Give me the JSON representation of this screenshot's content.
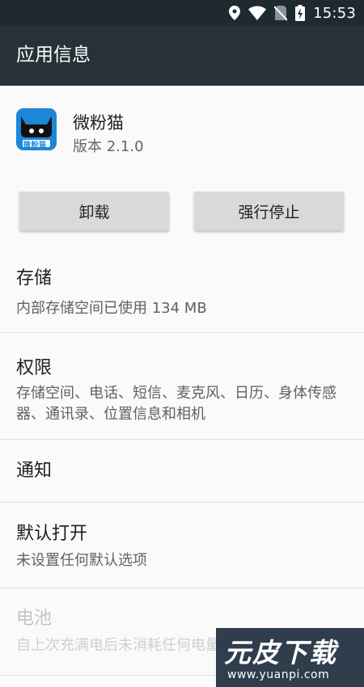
{
  "status_bar": {
    "time": "15:53",
    "icons": [
      "location-icon",
      "wifi-icon",
      "no-sim-icon",
      "battery-charging-icon"
    ]
  },
  "app_bar": {
    "title": "应用信息"
  },
  "app": {
    "name": "微粉猫",
    "version": "版本 2.1.0",
    "icon_label": "微粉猫",
    "icon_color": "#1c86d8"
  },
  "buttons": {
    "uninstall": "卸载",
    "force_stop": "强行停止"
  },
  "sections": {
    "storage": {
      "title": "存储",
      "summary": "内部存储空间已使用 134 MB"
    },
    "permissions": {
      "title": "权限",
      "summary": "存储空间、电话、短信、麦克风、日历、身体传感器、通讯录、位置信息和相机"
    },
    "notifications": {
      "title": "通知"
    },
    "open_by_default": {
      "title": "默认打开",
      "summary": "未设置任何默认选项"
    },
    "battery": {
      "title": "电池",
      "summary": "自上次充满电后未消耗任何电量"
    }
  },
  "watermark": {
    "text": "元皮下载",
    "url": "www.yuanpi.com"
  },
  "colors": {
    "status_bar": "#1f2930",
    "app_bar": "#263238",
    "background": "#fafafa",
    "button": "#d9d9d9"
  }
}
